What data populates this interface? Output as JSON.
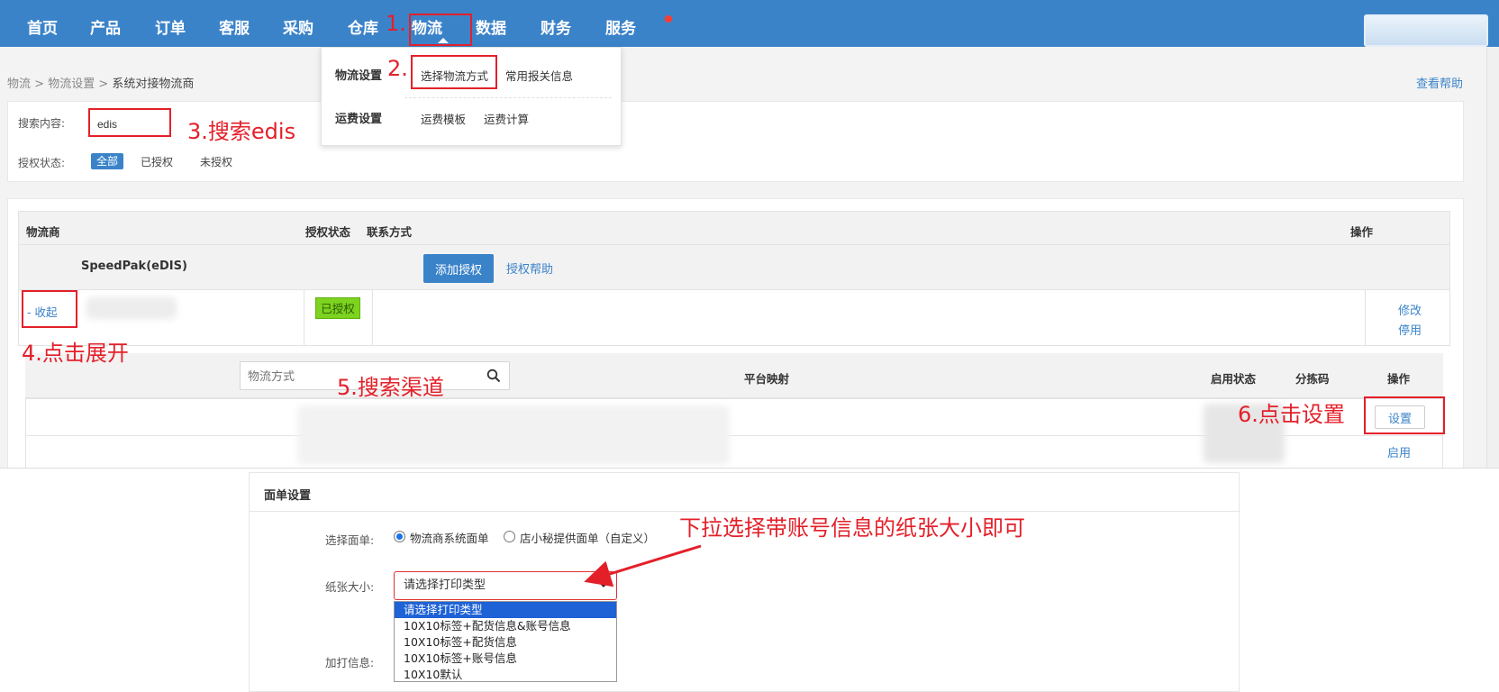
{
  "nav": {
    "items": [
      "首页",
      "产品",
      "订单",
      "客服",
      "采购",
      "仓库",
      "物流",
      "数据",
      "财务",
      "服务"
    ],
    "active": "物流"
  },
  "dropdown": {
    "group1": {
      "title": "物流设置",
      "items": [
        "选择物流方式",
        "常用报关信息"
      ]
    },
    "group2": {
      "title": "运费设置",
      "items": [
        "运费模板",
        "运费计算"
      ]
    }
  },
  "breadcrumb": {
    "parts": [
      "物流",
      "物流设置"
    ],
    "current": "系统对接物流商",
    "sep": ">"
  },
  "help_link": "查看帮助",
  "search": {
    "content_label": "搜索内容:",
    "value": "edis",
    "auth_label": "授权状态:",
    "filters": [
      "全部",
      "已授权",
      "未授权"
    ]
  },
  "table": {
    "headers": [
      "物流商",
      "授权状态",
      "联系方式",
      "操作"
    ],
    "provider": "SpeedPak(eDIS)",
    "add_auth_button": "添加授权",
    "auth_help": "授权帮助",
    "collapse": "- 收起",
    "badge": "已授权",
    "actions": [
      "修改",
      "停用"
    ]
  },
  "subtable": {
    "search_placeholder": "物流方式",
    "headers": [
      "平台映射",
      "启用状态",
      "分拣码",
      "操作"
    ],
    "set_button": "设置",
    "enable_link": "启用"
  },
  "panel": {
    "title": "面单设置",
    "choose_label": "选择面单:",
    "radio1": "物流商系统面单",
    "radio2": "店小秘提供面单（自定义）",
    "size_label": "纸张大小:",
    "select_value": "请选择打印类型",
    "extra_label": "加打信息:",
    "options": [
      "请选择打印类型",
      "10X10标签+配货信息&账号信息",
      "10X10标签+配货信息",
      "10X10标签+账号信息",
      "10X10默认"
    ]
  },
  "annotations": {
    "a1": "1.",
    "a2": "2.",
    "a3": "3.搜索edis",
    "a4": "4.点击展开",
    "a5": "5.搜索渠道",
    "a6": "6.点击设置",
    "a7": "下拉选择带账号信息的纸张大小即可"
  },
  "colors": {
    "nav_blue": "#3b83c9",
    "annotation_red": "#e3202a",
    "auth_green": "#7dd320",
    "option_selected": "#1e62d6"
  }
}
